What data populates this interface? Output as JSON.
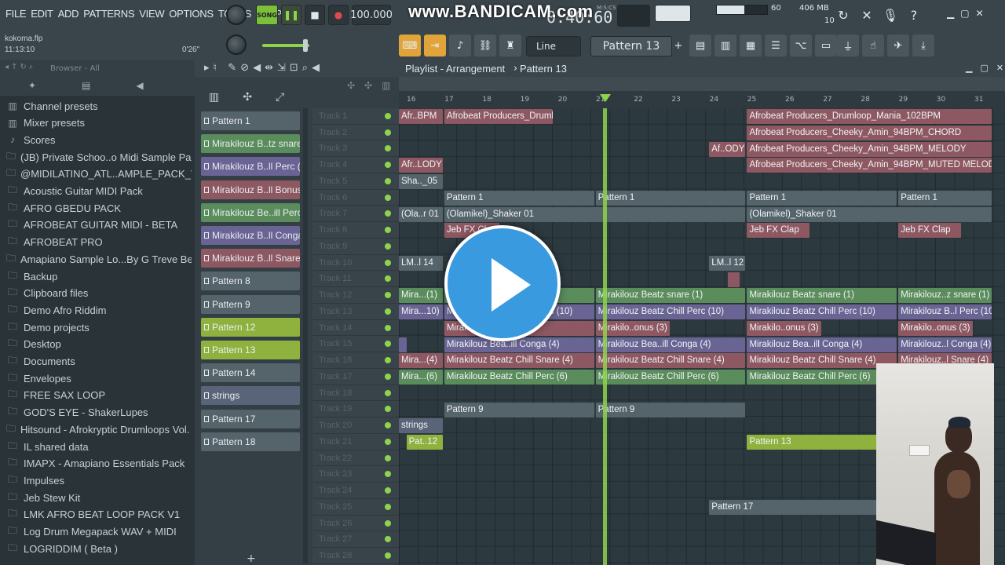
{
  "menu": [
    "FILE",
    "EDIT",
    "ADD",
    "PATTERNS",
    "VIEW",
    "OPTIONS",
    "TOOLS",
    "HELP"
  ],
  "transport": {
    "song_label": "SONG",
    "tempo": "100.000",
    "time": "0:40:60",
    "time_unit": "M:S:CS"
  },
  "watermark": "www.BANDICAM.com",
  "project": {
    "filename": "kokoma.flp",
    "position": "11:13:10",
    "duration": "0'26\""
  },
  "meters": {
    "cpu": "60",
    "memory": "406 MB",
    "polyphony": "10"
  },
  "toolbar": {
    "snap": "Line",
    "pattern": "Pattern 13"
  },
  "browser": {
    "header": "Browser - All",
    "items": [
      {
        "label": "Channel presets",
        "icon": "preset-icon"
      },
      {
        "label": "Mixer presets",
        "icon": "preset-icon"
      },
      {
        "label": "Scores",
        "icon": "note-icon"
      },
      {
        "label": "(JB) Private Schoo..o Midi Sample Pack",
        "icon": "folder-icon"
      },
      {
        "label": "@MIDILATINO_ATL..AMPLE_PACK_VOL_3",
        "icon": "folder-icon"
      },
      {
        "label": "Acoustic Guitar MIDI Pack",
        "icon": "folder-icon"
      },
      {
        "label": "AFRO GBEDU PACK",
        "icon": "folder-icon"
      },
      {
        "label": "AFROBEAT GUITAR MIDI - BETA",
        "icon": "folder-icon"
      },
      {
        "label": "AFROBEAT PRO",
        "icon": "folder-icon"
      },
      {
        "label": "Amapiano Sample Lo...By G Treve BeatZ",
        "icon": "folder-icon"
      },
      {
        "label": "Backup",
        "icon": "folder-icon"
      },
      {
        "label": "Clipboard files",
        "icon": "folder-icon"
      },
      {
        "label": "Demo Afro Riddim",
        "icon": "folder-icon"
      },
      {
        "label": "Demo projects",
        "icon": "folder-icon"
      },
      {
        "label": "Desktop",
        "icon": "folder-icon"
      },
      {
        "label": "Documents",
        "icon": "folder-icon"
      },
      {
        "label": "Envelopes",
        "icon": "folder-icon"
      },
      {
        "label": "FREE SAX LOOP",
        "icon": "folder-icon"
      },
      {
        "label": "GOD'S EYE - ShakerLupes",
        "icon": "folder-icon"
      },
      {
        "label": "Hitsound - Afrokryptic Drumloops Vol. 1",
        "icon": "folder-icon"
      },
      {
        "label": "IL shared data",
        "icon": "folder-icon"
      },
      {
        "label": "IMAPX - Amapiano Essentials Pack",
        "icon": "folder-icon"
      },
      {
        "label": "Impulses",
        "icon": "folder-icon"
      },
      {
        "label": "Jeb Stew Kit",
        "icon": "folder-icon"
      },
      {
        "label": "LMK AFRO BEAT LOOP PACK V1",
        "icon": "folder-icon"
      },
      {
        "label": "Log Drum Megapack WAV + MIDI",
        "icon": "folder-icon"
      },
      {
        "label": "LOGRIDDIM ( Beta )",
        "icon": "folder-icon"
      }
    ]
  },
  "patterns": [
    {
      "label": "Pattern 1",
      "color": "#55636a"
    },
    {
      "label": "Mirakilouz B..tz snare (1)",
      "color": "#5a8c5c"
    },
    {
      "label": "Mirakilouz B..ll Perc (10)",
      "color": "#6a6494"
    },
    {
      "label": "Mirakilouz B..ll Bonus (3)",
      "color": "#8e5862"
    },
    {
      "label": "Mirakilouz Be..ill Perc (6)",
      "color": "#5a8c5c"
    },
    {
      "label": "Mirakilouz B..ll Conga (4)",
      "color": "#6a6494"
    },
    {
      "label": "Mirakilouz B..ll Snare (4)",
      "color": "#8e5862"
    },
    {
      "label": "Pattern 8",
      "color": "#55636a"
    },
    {
      "label": "Pattern 9",
      "color": "#55636a"
    },
    {
      "label": "Pattern 12",
      "color": "#8fb23f"
    },
    {
      "label": "Pattern 13",
      "color": "#8fb23f"
    },
    {
      "label": "Pattern 14",
      "color": "#55636a"
    },
    {
      "label": "strings",
      "color": "#5a6478"
    },
    {
      "label": "Pattern 17",
      "color": "#55636a"
    },
    {
      "label": "Pattern 18",
      "color": "#55636a"
    }
  ],
  "playlist": {
    "title": "Playlist - Arrangement",
    "pattern": "Pattern 13"
  },
  "ruler": [
    "16",
    "17",
    "18",
    "19",
    "20",
    "21",
    "22",
    "23",
    "24",
    "25",
    "26",
    "27",
    "28",
    "29",
    "30",
    "31"
  ],
  "tracks": [
    "Track 1",
    "Track 2",
    "Track 3",
    "Track 4",
    "Track 5",
    "Track 6",
    "Track 7",
    "Track 8",
    "Track 9",
    "Track 10",
    "Track 11",
    "Track 12",
    "Track 13",
    "Track 14",
    "Track 15",
    "Track 16",
    "Track 17",
    "Track 18",
    "Track 19",
    "Track 20",
    "Track 21",
    "Track 22",
    "Track 23",
    "Track 24",
    "Track 25",
    "Track 26",
    "Track 27",
    "Track 28"
  ],
  "clips": [
    {
      "row": 0,
      "start": 0,
      "len": 2.4,
      "label": "Afr..BPM",
      "cls": "c-red"
    },
    {
      "row": 0,
      "start": 2.4,
      "len": 5.8,
      "label": "Afrobeat Producers_Drumloop_Mania_102BPM",
      "cls": "c-red"
    },
    {
      "row": 0,
      "start": 18.4,
      "len": 13,
      "label": "Afrobeat Producers_Drumloop_Mania_102BPM",
      "cls": "c-red"
    },
    {
      "row": 1,
      "start": 18.4,
      "len": 13,
      "label": "Afrobeat Producers_Cheeky_Amin_94BPM_CHORD",
      "cls": "c-red"
    },
    {
      "row": 2,
      "start": 16.4,
      "len": 2,
      "label": "Af..ODY",
      "cls": "c-red"
    },
    {
      "row": 2,
      "start": 18.4,
      "len": 13,
      "label": "Afrobeat Producers_Cheeky_Amin_94BPM_MELODY",
      "cls": "c-red"
    },
    {
      "row": 3,
      "start": 0,
      "len": 2.4,
      "label": "Afr..LODY",
      "cls": "c-red"
    },
    {
      "row": 3,
      "start": 18.4,
      "len": 13,
      "label": "Afrobeat Producers_Cheeky_Amin_94BPM_MUTED MELODY",
      "cls": "c-red"
    },
    {
      "row": 4,
      "start": 0,
      "len": 2.4,
      "label": "Sha.._05",
      "cls": "c-gry"
    },
    {
      "row": 5,
      "start": 2.4,
      "len": 8,
      "label": "Pattern 1",
      "cls": "c-gry"
    },
    {
      "row": 5,
      "start": 10.4,
      "len": 8,
      "label": "Pattern 1",
      "cls": "c-gry"
    },
    {
      "row": 5,
      "start": 18.4,
      "len": 8,
      "label": "Pattern 1",
      "cls": "c-gry"
    },
    {
      "row": 5,
      "start": 26.4,
      "len": 5,
      "label": "Pattern 1",
      "cls": "c-gry"
    },
    {
      "row": 6,
      "start": 0,
      "len": 2.4,
      "label": "(Ola..r 01",
      "cls": "c-gry"
    },
    {
      "row": 6,
      "start": 2.4,
      "len": 16,
      "label": "(Olamikel)_Shaker 01",
      "cls": "c-gry"
    },
    {
      "row": 6,
      "start": 18.4,
      "len": 13,
      "label": "(Olamikel)_Shaker 01",
      "cls": "c-gry"
    },
    {
      "row": 7,
      "start": 2.4,
      "len": 3,
      "label": "Jeb FX Clap",
      "cls": "c-red"
    },
    {
      "row": 7,
      "start": 18.4,
      "len": 3.4,
      "label": "Jeb FX Clap",
      "cls": "c-red"
    },
    {
      "row": 7,
      "start": 26.4,
      "len": 3.4,
      "label": "Jeb FX Clap",
      "cls": "c-red"
    },
    {
      "row": 9,
      "start": 0,
      "len": 2.4,
      "label": "LM..l 14",
      "cls": "c-gry"
    },
    {
      "row": 9,
      "start": 16.4,
      "len": 2,
      "label": "LM..l 12",
      "cls": "c-gry"
    },
    {
      "row": 10,
      "start": 17.4,
      "len": 0.7,
      "label": "",
      "cls": "c-red"
    },
    {
      "row": 11,
      "start": 0,
      "len": 2.4,
      "label": "Mira...(1)",
      "cls": "c-grn"
    },
    {
      "row": 11,
      "start": 2.4,
      "len": 8,
      "label": "Mirakilouz Beatz snare (1)",
      "cls": "c-grn"
    },
    {
      "row": 11,
      "start": 10.4,
      "len": 8,
      "label": "Mirakilouz Beatz snare (1)",
      "cls": "c-grn"
    },
    {
      "row": 11,
      "start": 18.4,
      "len": 8,
      "label": "Mirakilouz Beatz snare (1)",
      "cls": "c-grn"
    },
    {
      "row": 11,
      "start": 26.4,
      "len": 5,
      "label": "Mirakilouz..z snare (1)",
      "cls": "c-grn"
    },
    {
      "row": 12,
      "start": 0,
      "len": 2.4,
      "label": "Mira...10)",
      "cls": "c-pur"
    },
    {
      "row": 12,
      "start": 2.4,
      "len": 8,
      "label": "Mirakilouz Beatz Chill Perc (10)",
      "cls": "c-pur"
    },
    {
      "row": 12,
      "start": 10.4,
      "len": 8,
      "label": "Mirakilouz Beatz Chill Perc (10)",
      "cls": "c-pur"
    },
    {
      "row": 12,
      "start": 18.4,
      "len": 8,
      "label": "Mirakilouz Beatz Chill Perc (10)",
      "cls": "c-pur"
    },
    {
      "row": 12,
      "start": 26.4,
      "len": 5,
      "label": "Mirakilouz B..l Perc (10)",
      "cls": "c-pur"
    },
    {
      "row": 13,
      "start": 2.4,
      "len": 8,
      "label": "Mirakilo..onus (3)",
      "cls": "c-red"
    },
    {
      "row": 13,
      "start": 10.4,
      "len": 4,
      "label": "Mirakilo..onus (3)",
      "cls": "c-red"
    },
    {
      "row": 13,
      "start": 18.4,
      "len": 4,
      "label": "Mirakilo..onus (3)",
      "cls": "c-red"
    },
    {
      "row": 13,
      "start": 26.4,
      "len": 4,
      "label": "Mirakilo..onus (3)",
      "cls": "c-red"
    },
    {
      "row": 14,
      "start": 0,
      "len": 0.5,
      "label": "",
      "cls": "c-pur"
    },
    {
      "row": 14,
      "start": 2.4,
      "len": 8,
      "label": "Mirakilouz Bea..ill Conga (4)",
      "cls": "c-pur"
    },
    {
      "row": 14,
      "start": 10.4,
      "len": 8,
      "label": "Mirakilouz Bea..ill Conga (4)",
      "cls": "c-pur"
    },
    {
      "row": 14,
      "start": 18.4,
      "len": 8,
      "label": "Mirakilouz Bea..ill Conga (4)",
      "cls": "c-pur"
    },
    {
      "row": 14,
      "start": 26.4,
      "len": 5,
      "label": "Mirakilouz..l Conga (4)",
      "cls": "c-pur"
    },
    {
      "row": 15,
      "start": 0,
      "len": 2.4,
      "label": "Mira...(4)",
      "cls": "c-red"
    },
    {
      "row": 15,
      "start": 2.4,
      "len": 8,
      "label": "Mirakilouz Beatz Chill Snare (4)",
      "cls": "c-red"
    },
    {
      "row": 15,
      "start": 10.4,
      "len": 8,
      "label": "Mirakilouz Beatz Chill Snare (4)",
      "cls": "c-red"
    },
    {
      "row": 15,
      "start": 18.4,
      "len": 8,
      "label": "Mirakilouz Beatz Chill Snare (4)",
      "cls": "c-red"
    },
    {
      "row": 15,
      "start": 26.4,
      "len": 5,
      "label": "Mirakilouz..l Snare (4)",
      "cls": "c-red"
    },
    {
      "row": 16,
      "start": 0,
      "len": 2.4,
      "label": "Mira...(6)",
      "cls": "c-grn"
    },
    {
      "row": 16,
      "start": 2.4,
      "len": 8,
      "label": "Mirakilouz Beatz Chill Perc (6)",
      "cls": "c-grn"
    },
    {
      "row": 16,
      "start": 10.4,
      "len": 8,
      "label": "Mirakilouz Beatz Chill Perc (6)",
      "cls": "c-grn"
    },
    {
      "row": 16,
      "start": 18.4,
      "len": 8,
      "label": "Mirakilouz Beatz Chill Perc (6)",
      "cls": "c-grn"
    },
    {
      "row": 18,
      "start": 2.4,
      "len": 8,
      "label": "Pattern 9",
      "cls": "c-gry"
    },
    {
      "row": 18,
      "start": 10.4,
      "len": 8,
      "label": "Pattern 9",
      "cls": "c-gry"
    },
    {
      "row": 19,
      "start": 0,
      "len": 2.4,
      "label": "strings",
      "cls": "c-blu"
    },
    {
      "row": 20,
      "start": 0.4,
      "len": 2,
      "label": "Pat..12",
      "cls": "c-lime"
    },
    {
      "row": 20,
      "start": 18.4,
      "len": 8,
      "label": "Pattern 13",
      "cls": "c-lime"
    },
    {
      "row": 24,
      "start": 16.4,
      "len": 9,
      "label": "Pattern 17",
      "cls": "c-gry"
    }
  ]
}
